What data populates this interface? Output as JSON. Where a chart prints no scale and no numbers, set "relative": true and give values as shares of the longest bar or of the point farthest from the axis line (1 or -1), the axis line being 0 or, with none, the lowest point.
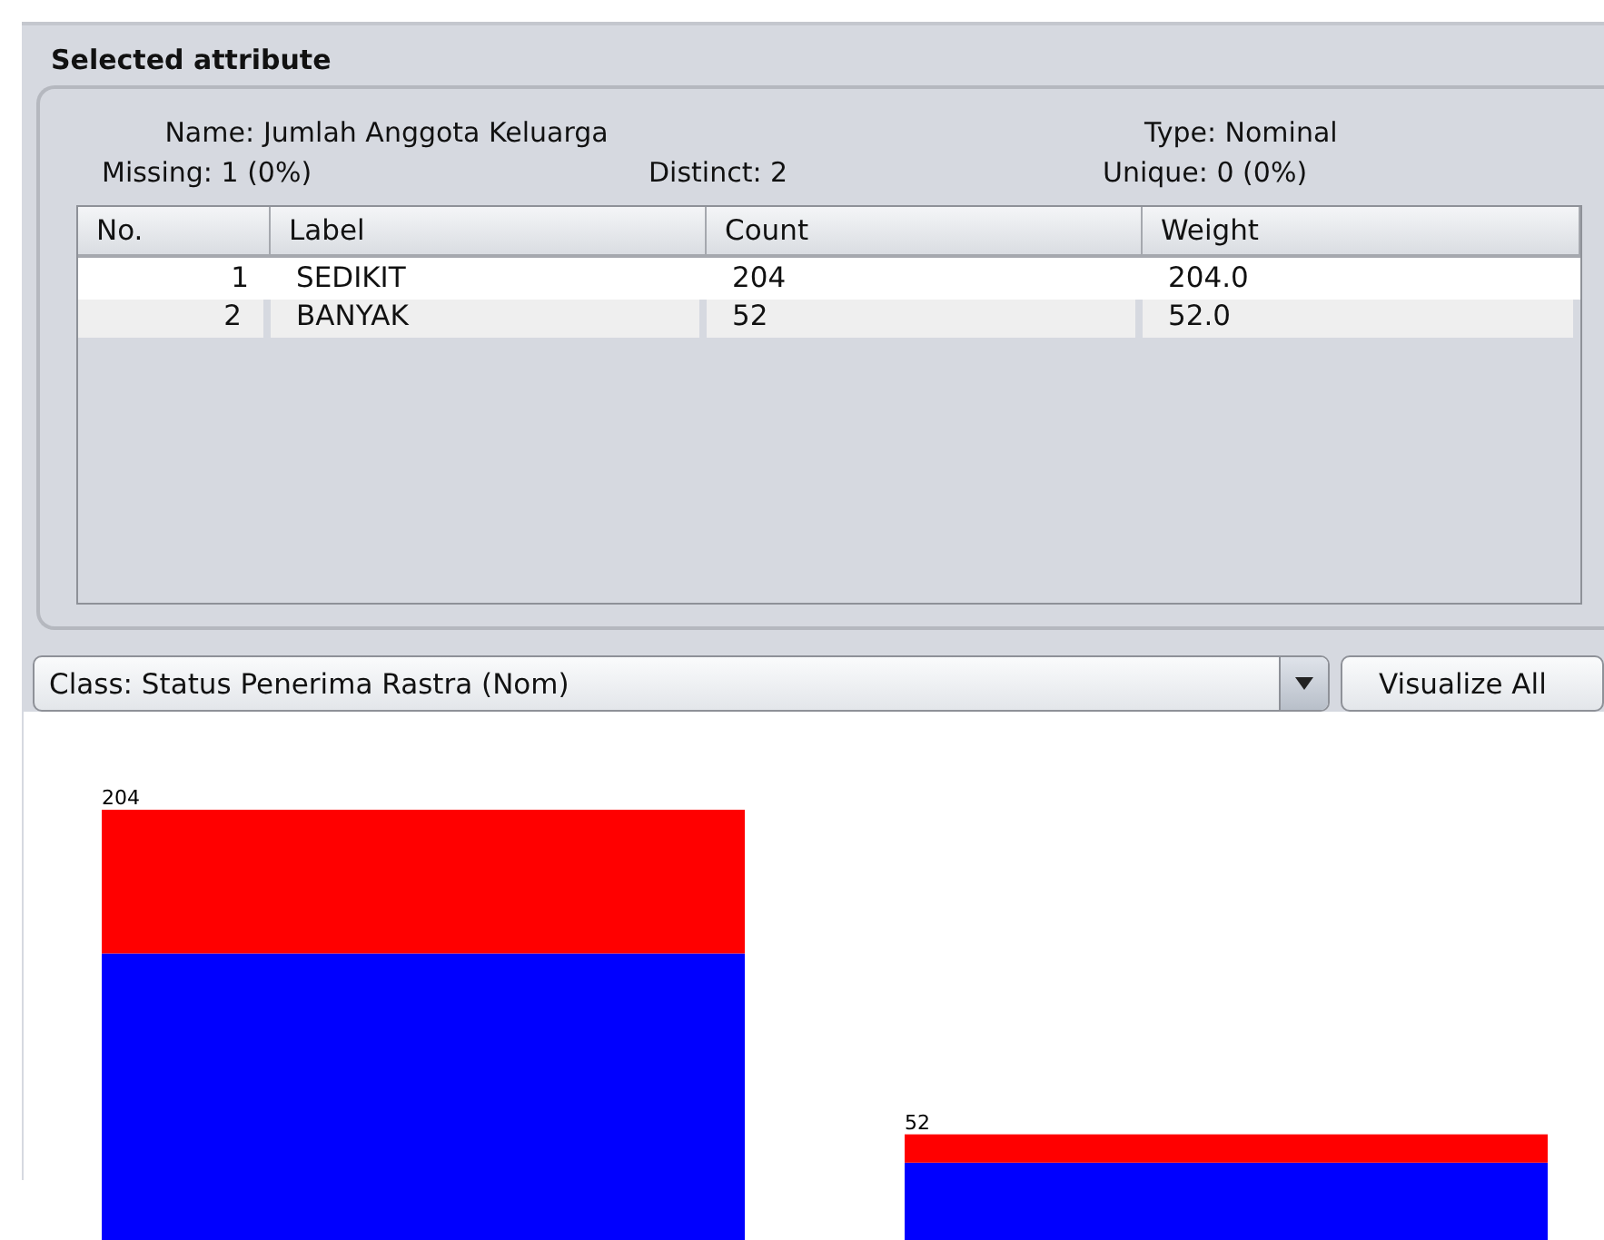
{
  "panel": {
    "title": "Selected attribute",
    "name_label": "Name:",
    "name": "Jumlah Anggota Keluarga",
    "type_label": "Type:",
    "type": "Nominal",
    "missing_label": "Missing:",
    "missing": "1 (0%)",
    "distinct_label": "Distinct:",
    "distinct": "2",
    "unique_label": "Unique:",
    "unique": "0 (0%)"
  },
  "table": {
    "columns": [
      "No.",
      "Label",
      "Count",
      "Weight"
    ],
    "rows": [
      {
        "no": "1",
        "label": "SEDIKIT",
        "count": "204",
        "weight": "204.0"
      },
      {
        "no": "2",
        "label": "BANYAK",
        "count": "52",
        "weight": "52.0"
      }
    ]
  },
  "class_selector": {
    "value": "Class: Status Penerima Rastra (Nom)"
  },
  "visualize_button": "Visualize All",
  "chart_data": {
    "type": "bar",
    "stacked": true,
    "relative": true,
    "value_labels": [
      [
        null,
        null
      ],
      [
        "204",
        "52"
      ]
    ],
    "series": [
      {
        "color": "#0000ff",
        "values": [
          0.67,
          0.19
        ]
      },
      {
        "color": "#ff0000",
        "values": [
          0.33,
          0.065
        ]
      }
    ]
  }
}
